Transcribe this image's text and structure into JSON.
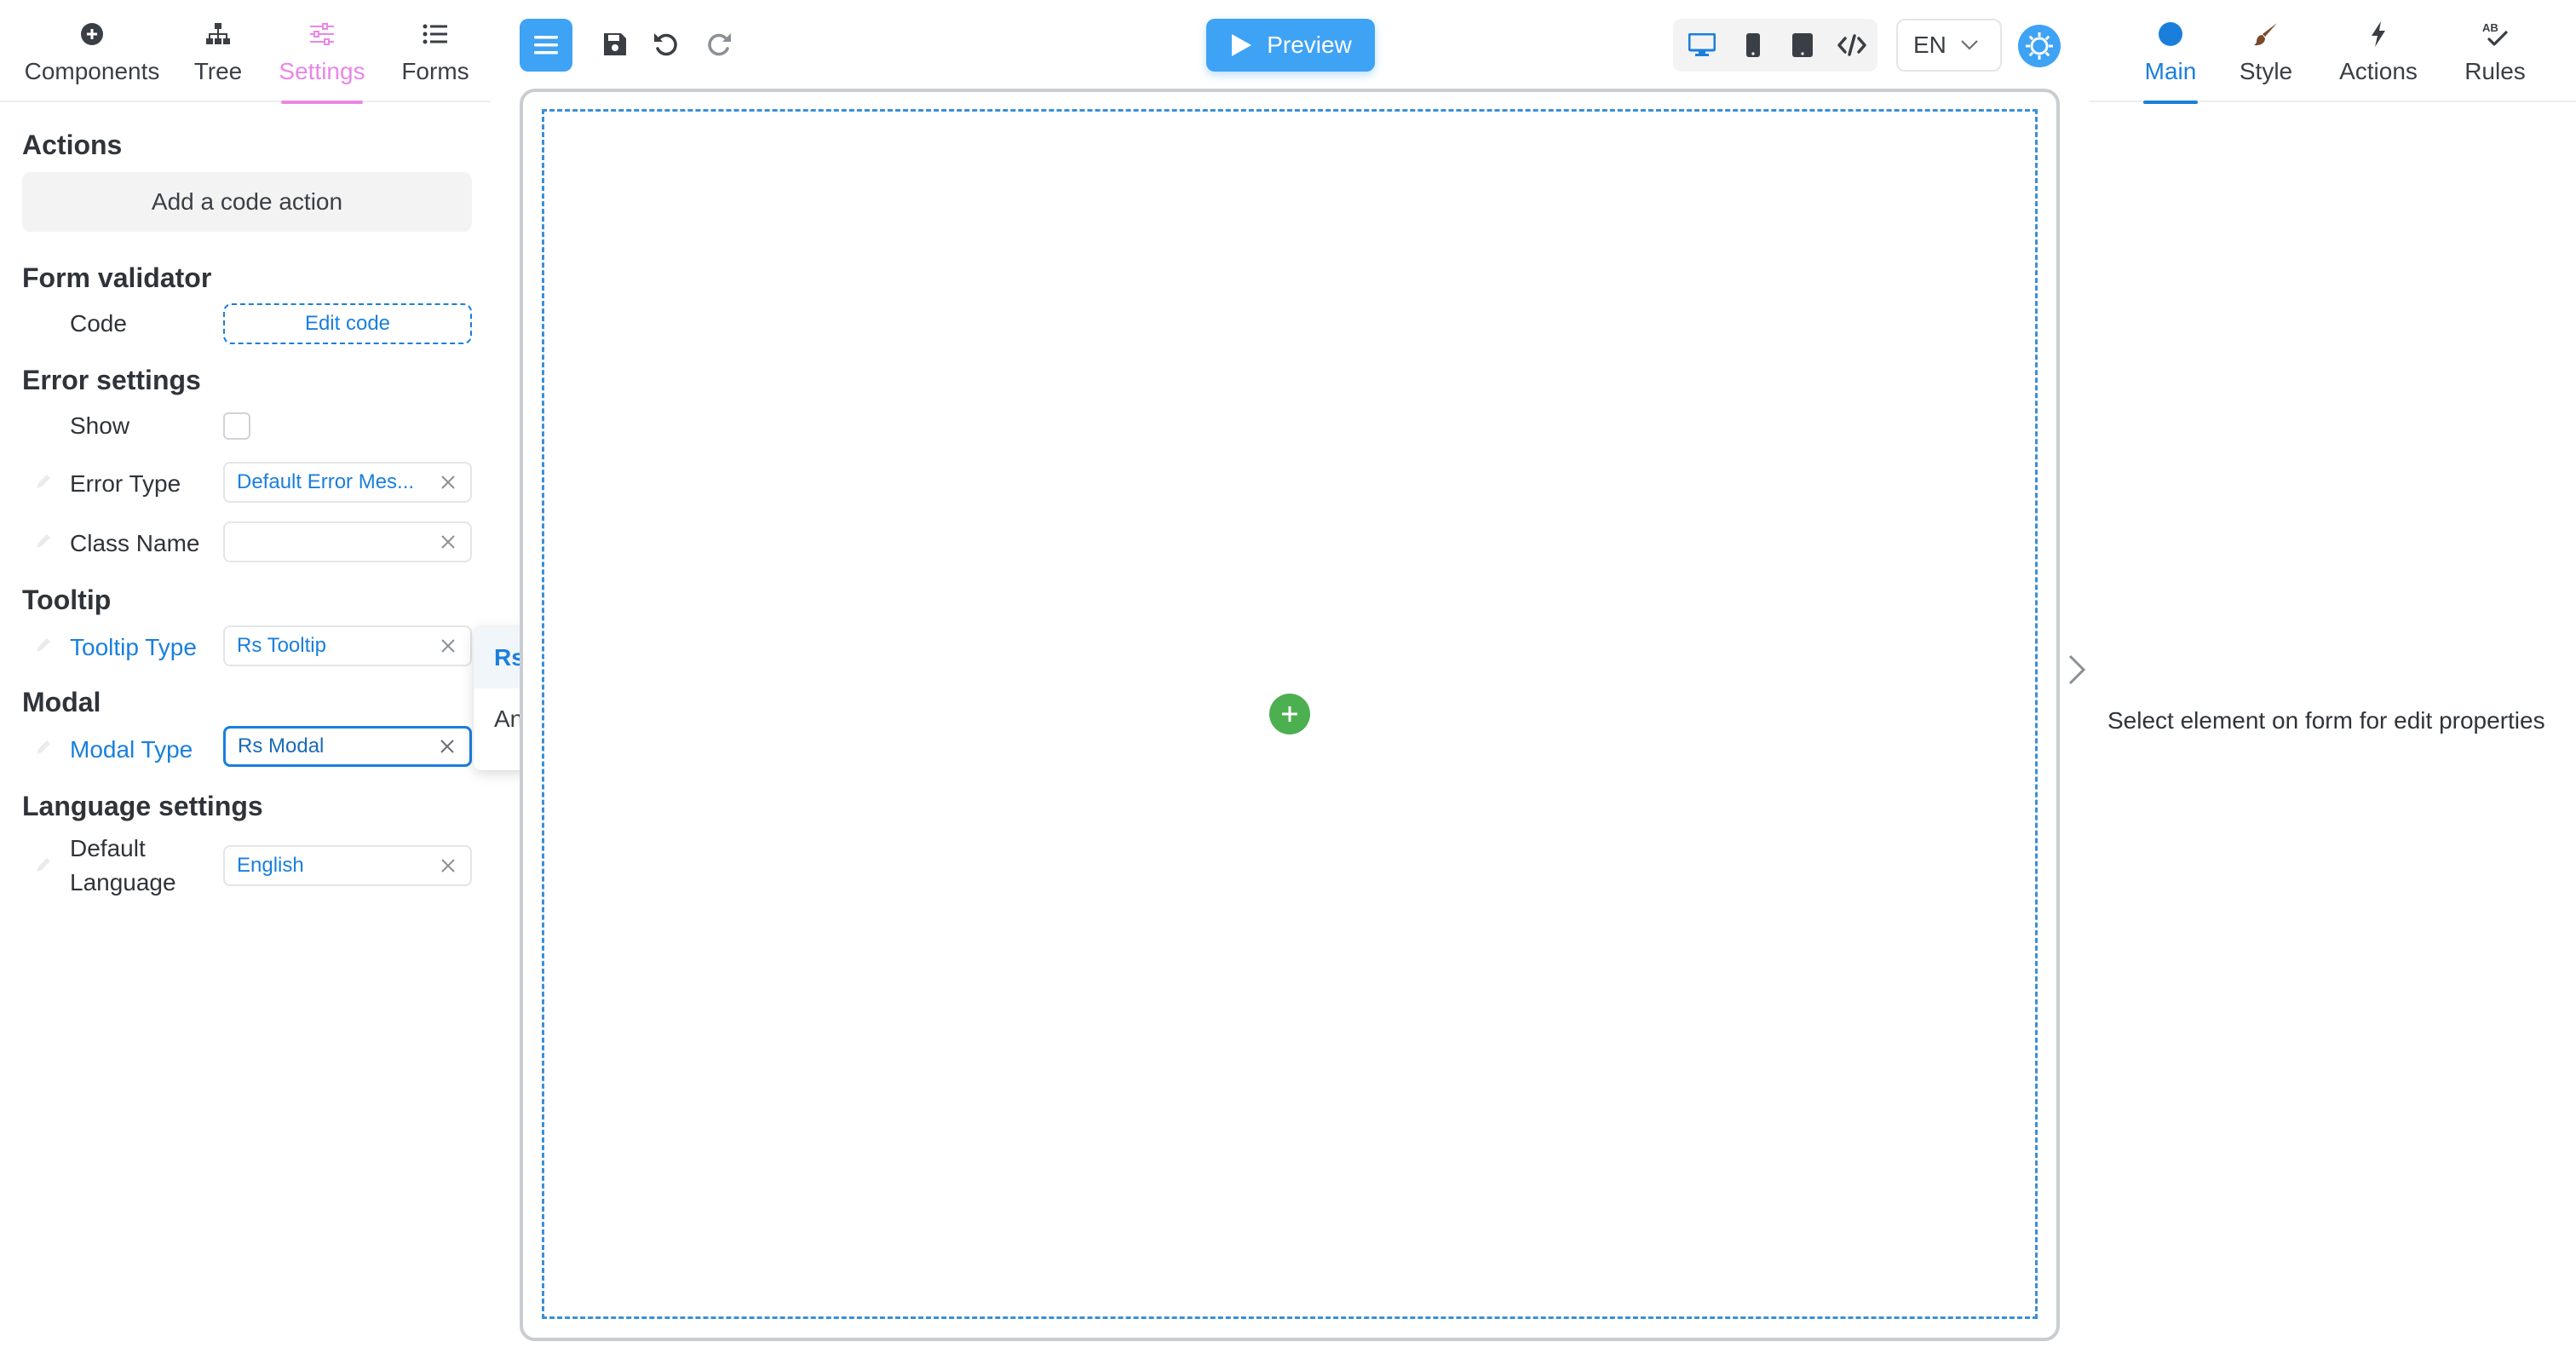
{
  "left_tabs": [
    {
      "label": "Components",
      "icon": "plus-circle-icon"
    },
    {
      "label": "Tree",
      "icon": "sitemap-icon"
    },
    {
      "label": "Settings",
      "icon": "sliders-icon",
      "active": true
    },
    {
      "label": "Forms",
      "icon": "list-icon"
    }
  ],
  "settings": {
    "actions": {
      "title": "Actions",
      "add_button": "Add a code action"
    },
    "form_validator": {
      "title": "Form validator",
      "code_label": "Code",
      "edit_button": "Edit code"
    },
    "error_settings": {
      "title": "Error settings",
      "show_label": "Show",
      "show_checked": false,
      "error_type_label": "Error Type",
      "error_type_value": "Default Error Mes...",
      "class_name_label": "Class Name",
      "class_name_value": ""
    },
    "tooltip": {
      "title": "Tooltip",
      "type_label": "Tooltip Type",
      "type_value": "Rs Tooltip"
    },
    "modal": {
      "title": "Modal",
      "type_label": "Modal Type",
      "type_value": "Rs Modal"
    },
    "language": {
      "title": "Language settings",
      "default_label_line1": "Default",
      "default_label_line2": "Language",
      "default_value": "English"
    }
  },
  "modal_dropdown": {
    "options": [
      "Rs Modal",
      "Ant Modal"
    ],
    "selected": "Rs Modal"
  },
  "toolbar": {
    "menu_icon": "hamburger-icon",
    "save_icon": "save-icon",
    "undo_icon": "undo-icon",
    "redo_icon": "redo-icon",
    "preview_label": "Preview",
    "devices": [
      "desktop-icon",
      "mobile-icon",
      "tablet-icon",
      "code-icon"
    ],
    "language": "EN",
    "settings_icon": "gear-icon"
  },
  "right_tabs": [
    {
      "label": "Main",
      "icon": "circle-icon",
      "active": true
    },
    {
      "label": "Style",
      "icon": "brush-icon"
    },
    {
      "label": "Actions",
      "icon": "bolt-icon"
    },
    {
      "label": "Rules",
      "icon": "spellcheck-icon"
    }
  ],
  "right_panel": {
    "hint": "Select element on form for edit properties"
  },
  "colors": {
    "accent": "#3ea2f5",
    "link_blue": "#1a7fdc",
    "settings_tab": "#ea86e8",
    "add_green": "#4cb050"
  }
}
